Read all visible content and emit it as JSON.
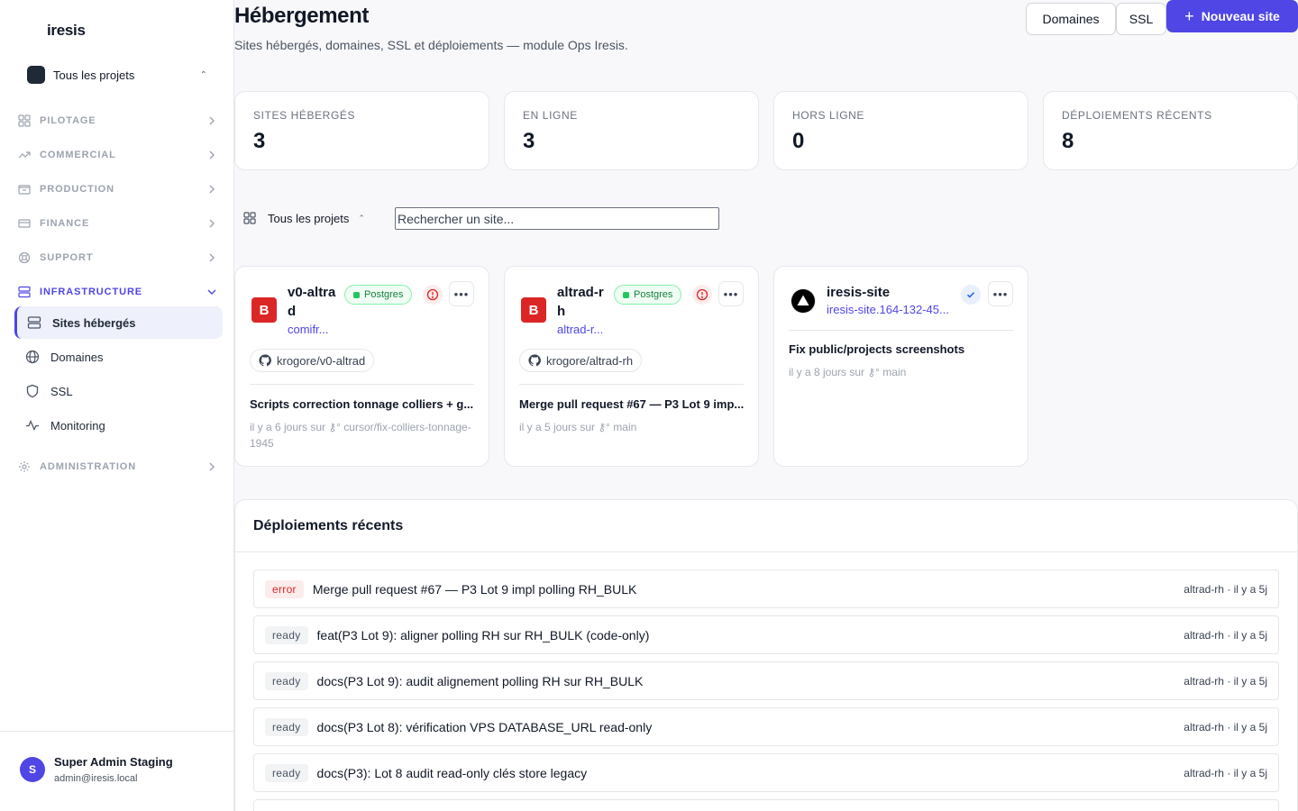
{
  "brand": "iresis",
  "project_selector": {
    "label": "Tous les projets"
  },
  "nav": {
    "groups": [
      {
        "label": "PILOTAGE"
      },
      {
        "label": "COMMERCIAL"
      },
      {
        "label": "PRODUCTION"
      },
      {
        "label": "FINANCE"
      },
      {
        "label": "SUPPORT"
      },
      {
        "label": "INFRASTRUCTURE"
      },
      {
        "label": "ADMINISTRATION"
      }
    ],
    "infra_items": [
      {
        "label": "Sites hébergés"
      },
      {
        "label": "Domaines"
      },
      {
        "label": "SSL"
      },
      {
        "label": "Monitoring"
      }
    ]
  },
  "user": {
    "initial": "S",
    "name": "Super Admin Staging",
    "email": "admin@iresis.local"
  },
  "header": {
    "title": "Hébergement",
    "subtitle": "Sites hébergés, domaines, SSL et déploiements — module Ops Iresis.",
    "btn_domaines": "Domaines",
    "btn_ssl": "SSL",
    "btn_new": "Nouveau site"
  },
  "stats": [
    {
      "label": "Sites hébergés",
      "value": "3"
    },
    {
      "label": "En ligne",
      "value": "3"
    },
    {
      "label": "Hors ligne",
      "value": "0"
    },
    {
      "label": "Déploiements récents",
      "value": "8"
    }
  ],
  "filters": {
    "project": "Tous les projets",
    "search_placeholder": "Rechercher un site..."
  },
  "sites": [
    {
      "logo": "B",
      "name": "v0-altrad",
      "url": "comifr...",
      "db": "Postgres",
      "repo": "krogore/v0-altrad",
      "commit": "Scripts correction tonnage colliers + g...",
      "meta": "il y a 6 jours sur ⚷° cursor/fix-colliers-tonnage-1945"
    },
    {
      "logo": "B",
      "name": "altrad-rh",
      "url": "altrad-r...",
      "db": "Postgres",
      "repo": "krogore/altrad-rh",
      "commit": "Merge pull request #67 — P3 Lot 9 imp...",
      "meta": "il y a 5 jours sur ⚷° main"
    },
    {
      "name": "iresis-site",
      "url": "iresis-site.164-132-45...",
      "commit": "Fix public/projects screenshots",
      "meta": "il y a 8 jours sur ⚷° main"
    }
  ],
  "deploys": {
    "title": "Déploiements récents",
    "rows": [
      {
        "status": "error",
        "message": "Merge pull request #67 — P3 Lot 9 impl polling RH_BULK",
        "meta": "altrad-rh · il y a 5j"
      },
      {
        "status": "ready",
        "message": "feat(P3 Lot 9): aligner polling RH sur RH_BULK (code-only)",
        "meta": "altrad-rh · il y a 5j"
      },
      {
        "status": "ready",
        "message": "docs(P3 Lot 9): audit alignement polling RH sur RH_BULK",
        "meta": "altrad-rh · il y a 5j"
      },
      {
        "status": "ready",
        "message": "docs(P3 Lot 8): vérification VPS DATABASE_URL read-only",
        "meta": "altrad-rh · il y a 5j"
      },
      {
        "status": "ready",
        "message": "docs(P3): Lot 8 audit read-only clés store legacy",
        "meta": "altrad-rh · il y a 5j"
      }
    ]
  },
  "colors": {
    "accent": "#4f46e5",
    "error": "#dc2626",
    "success": "#22c55e",
    "brand_logo": "#dc2626"
  }
}
